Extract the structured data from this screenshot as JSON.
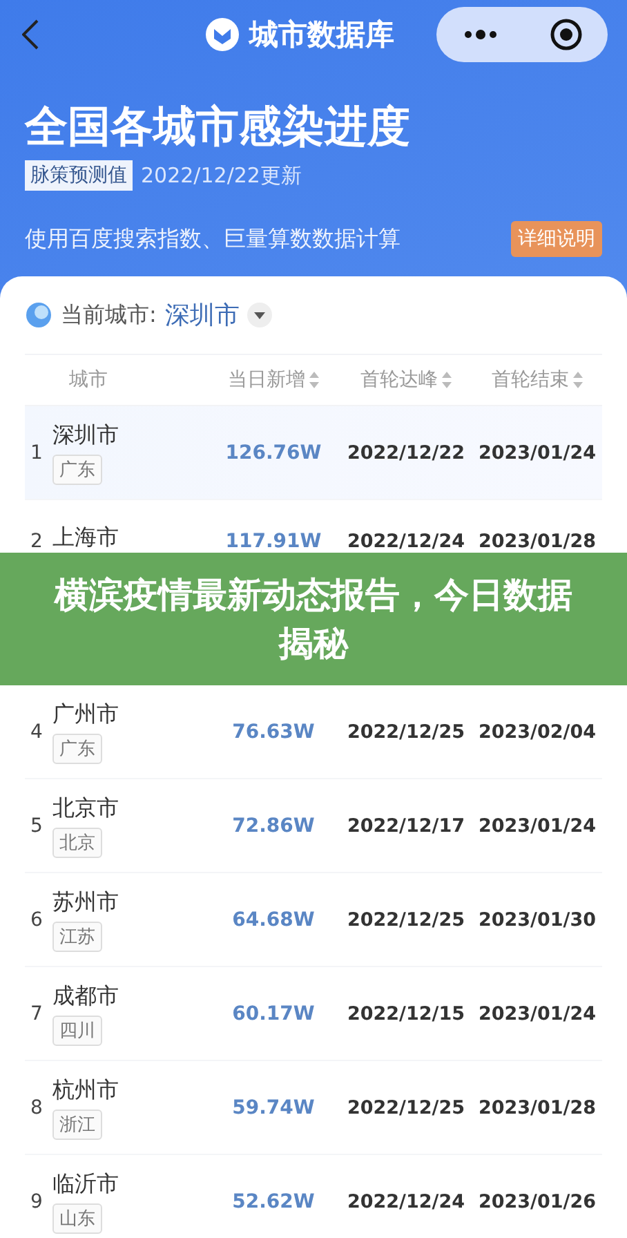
{
  "nav": {
    "title": "城市数据库"
  },
  "header": {
    "title": "全国各城市感染进度",
    "tag": "脉策预测值",
    "updated": "2022/12/22更新",
    "description": "使用百度搜索指数、巨量算数数据计算",
    "detail_button": "详细说明"
  },
  "current_city": {
    "label": "当前城市:",
    "value": "深圳市"
  },
  "table": {
    "columns": [
      {
        "label": "城市",
        "sortable": false
      },
      {
        "label": "当日新增",
        "sortable": true
      },
      {
        "label": "首轮达峰",
        "sortable": true
      },
      {
        "label": "首轮结束",
        "sortable": true
      }
    ],
    "rows": [
      {
        "rank": "1",
        "city": "深圳市",
        "province": "广东",
        "new": "126.76W",
        "peak": "2022/12/22",
        "end": "2023/01/24",
        "current": true
      },
      {
        "rank": "2",
        "city": "上海市",
        "new": "117.91W",
        "peak": "2022/12/24",
        "end": "2023/01/28",
        "current": false
      },
      {
        "rank": "4",
        "city": "广州市",
        "province": "广东",
        "new": "76.63W",
        "peak": "2022/12/25",
        "end": "2023/02/04",
        "current": false
      },
      {
        "rank": "5",
        "city": "北京市",
        "province": "北京",
        "new": "72.86W",
        "peak": "2022/12/17",
        "end": "2023/01/24",
        "current": false
      },
      {
        "rank": "6",
        "city": "苏州市",
        "province": "江苏",
        "new": "64.68W",
        "peak": "2022/12/25",
        "end": "2023/01/30",
        "current": false
      },
      {
        "rank": "7",
        "city": "成都市",
        "province": "四川",
        "new": "60.17W",
        "peak": "2022/12/15",
        "end": "2023/01/24",
        "current": false
      },
      {
        "rank": "8",
        "city": "杭州市",
        "province": "浙江",
        "new": "59.74W",
        "peak": "2022/12/25",
        "end": "2023/01/28",
        "current": false
      },
      {
        "rank": "9",
        "city": "临沂市",
        "province": "山东",
        "new": "52.62W",
        "peak": "2022/12/24",
        "end": "2023/01/26",
        "current": false
      }
    ]
  },
  "banner": {
    "title": "横滨疫情最新动态报告，今日数据揭秘"
  }
}
